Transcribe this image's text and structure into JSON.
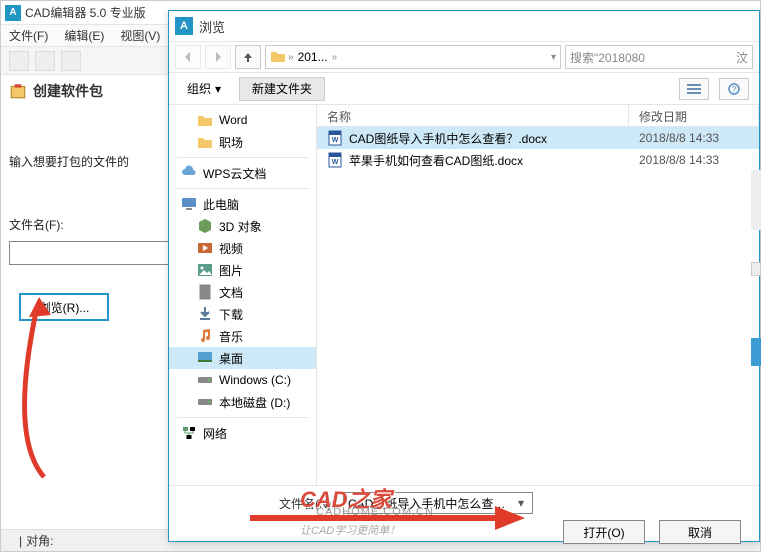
{
  "app": {
    "title": "CAD编辑器 5.0 专业版",
    "menu": {
      "file": "文件(F)",
      "edit": "编辑(E)",
      "view": "视图(V)"
    }
  },
  "wizard": {
    "title": "创建软件包",
    "prompt": "输入想要打包的文件的",
    "filename_label": "文件名(F):",
    "filename_value": "",
    "browse_btn": "浏览(R)..."
  },
  "status": {
    "left": "对角:"
  },
  "dialog": {
    "title": "浏览",
    "breadcrumb": {
      "folder": "201...",
      "sep": "»"
    },
    "search_placeholder": "搜索\"2018080",
    "search_suffix": "汶",
    "organize": "组织",
    "new_folder": "新建文件夹",
    "tree": [
      {
        "label": "Word",
        "icon": "folder",
        "indent": "sub"
      },
      {
        "label": "职场",
        "icon": "folder",
        "indent": "sub"
      },
      {
        "label": "WPS云文档",
        "icon": "cloud",
        "indent": "",
        "sep_before": true
      },
      {
        "label": "此电脑",
        "icon": "monitor",
        "indent": "",
        "sep_before": true
      },
      {
        "label": "3D 对象",
        "icon": "3d",
        "indent": "sub"
      },
      {
        "label": "视频",
        "icon": "video",
        "indent": "sub"
      },
      {
        "label": "图片",
        "icon": "pic",
        "indent": "sub"
      },
      {
        "label": "文档",
        "icon": "doc",
        "indent": "sub"
      },
      {
        "label": "下载",
        "icon": "dl",
        "indent": "sub"
      },
      {
        "label": "音乐",
        "icon": "music",
        "indent": "sub"
      },
      {
        "label": "桌面",
        "icon": "desktop",
        "indent": "sub",
        "selected": true
      },
      {
        "label": "Windows (C:)",
        "icon": "drive",
        "indent": "sub"
      },
      {
        "label": "本地磁盘 (D:)",
        "icon": "drive",
        "indent": "sub"
      },
      {
        "label": "网络",
        "icon": "network",
        "indent": "",
        "sep_before": true
      }
    ],
    "columns": {
      "name": "名称",
      "date": "修改日期"
    },
    "files": [
      {
        "name": "CAD图纸导入手机中怎么查看？.docx",
        "date": "2018/8/8 14:33",
        "selected": true
      },
      {
        "name": "苹果手机如何查看CAD图纸.docx",
        "date": "2018/8/8 14:33",
        "selected": false
      }
    ],
    "footer": {
      "filename_label": "文件名(N):",
      "filename_value": "CAD图纸导入手机中怎么查看？.c",
      "open": "打开(O)",
      "cancel": "取消"
    }
  },
  "watermark": {
    "main": "CAD之家",
    "url": "CADHOME.COM.CN",
    "slogan": "让CAD学习更简单！"
  }
}
